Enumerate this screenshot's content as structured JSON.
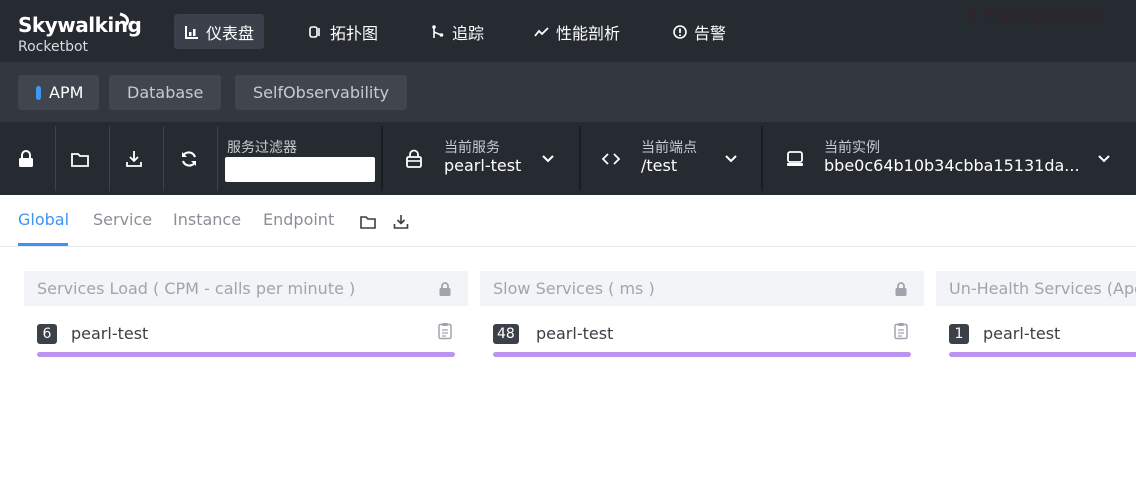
{
  "brand": {
    "name": "Skywalking",
    "sub": "Rocketbot"
  },
  "nav": [
    {
      "label": "仪表盘",
      "icon": "dashboard-icon",
      "active": true
    },
    {
      "label": "拓扑图",
      "icon": "topology-icon",
      "active": false
    },
    {
      "label": "追踪",
      "icon": "trace-icon",
      "active": false
    },
    {
      "label": "性能剖析",
      "icon": "profile-icon",
      "active": false
    },
    {
      "label": "告警",
      "icon": "alarm-icon",
      "active": false
    }
  ],
  "header_right": "2 2 0 0 0 0 0 0 0",
  "layers": [
    {
      "label": "APM",
      "active": true
    },
    {
      "label": "Database",
      "active": false
    },
    {
      "label": "SelfObservability",
      "active": false
    }
  ],
  "toolbar": {
    "icons": [
      "lock-icon",
      "folder-icon",
      "download-icon",
      "refresh-icon"
    ],
    "filter_label": "服务过滤器",
    "filter_value": "",
    "service": {
      "label": "当前服务",
      "value": "pearl-test"
    },
    "endpoint": {
      "label": "当前端点",
      "value": "/test"
    },
    "instance": {
      "label": "当前实例",
      "value": "bbe0c64b10b34cbba15131da..."
    }
  },
  "tabs": [
    {
      "label": "Global",
      "active": true
    },
    {
      "label": "Service",
      "active": false
    },
    {
      "label": "Instance",
      "active": false
    },
    {
      "label": "Endpoint",
      "active": false
    }
  ],
  "panels": [
    {
      "title": "Services Load ( CPM - calls per minute )",
      "rows": [
        {
          "value": "6",
          "name": "pearl-test"
        }
      ]
    },
    {
      "title": "Slow Services ( ms )",
      "rows": [
        {
          "value": "48",
          "name": "pearl-test"
        }
      ]
    },
    {
      "title": "Un-Health Services (Apdex)",
      "rows": [
        {
          "value": "1",
          "name": "pearl-test"
        }
      ]
    }
  ],
  "colors": {
    "accent": "#3d92f5",
    "bar": "#bd93f0",
    "nav_bg": "#262a31"
  }
}
